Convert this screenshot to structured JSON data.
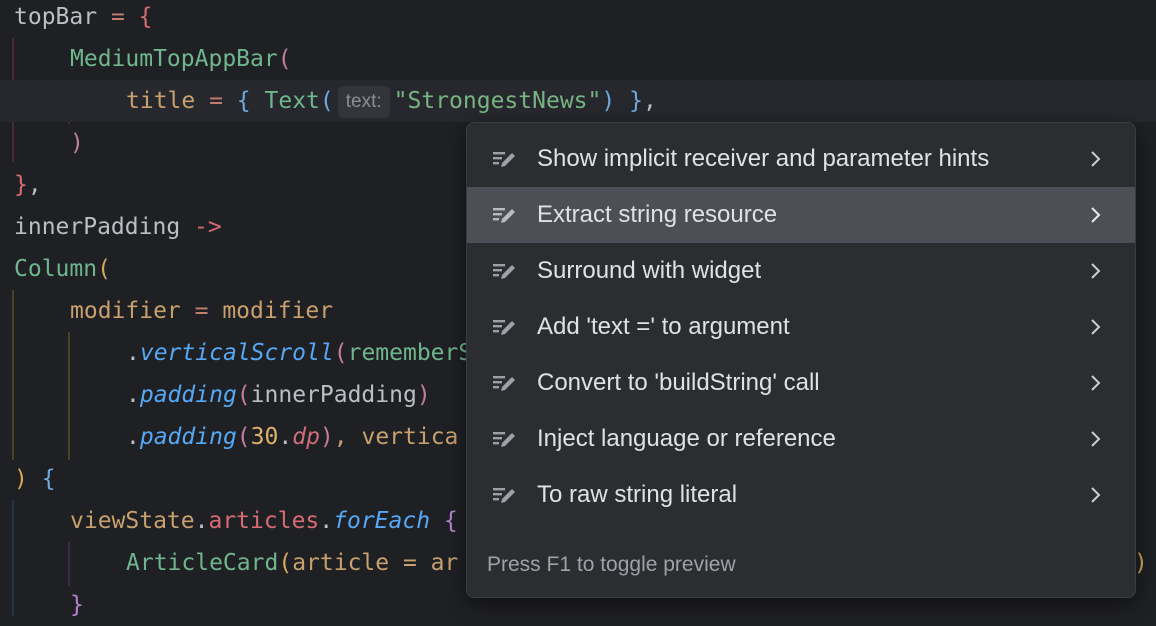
{
  "code": {
    "l1": {
      "name": "topBar",
      "eq": " = ",
      "brace": "{"
    },
    "l2": {
      "fn": "MediumTopAppBar",
      "paren": "("
    },
    "l3": {
      "prop": "title",
      "eq": " = ",
      "lb": "{ ",
      "fn": "Text",
      "paren": "(",
      "hint": "text:",
      "str": "\"StrongestNews\"",
      "rp": ")",
      "rb": " }",
      "comma": ","
    },
    "l4": {
      "paren": ")"
    },
    "l5": {
      "brace": "}",
      "comma": ","
    },
    "l6": {
      "name": "innerPadding",
      "arrow": " ->"
    },
    "l7": {
      "fn": "Column",
      "paren": "("
    },
    "l8": {
      "prop": "modifier",
      "eq": " = ",
      "val": "modifier"
    },
    "l9": {
      "dot": ".",
      "fn": "verticalScroll",
      "paren": "(",
      "arg": "rememberS"
    },
    "l10": {
      "dot": ".",
      "fn": "padding",
      "lp": "(",
      "arg": "innerPadding",
      "rp": ")"
    },
    "l11": {
      "dot": ".",
      "fn": "padding",
      "lp": "(",
      "num": "30",
      "dot2": ".",
      "unit": "dp",
      "rp": ")",
      "rest": ", vertica"
    },
    "l12": {
      "paren": ")",
      "brace": " {"
    },
    "l13": {
      "obj": "viewState",
      "dot": ".",
      "prop": "articles",
      "dot2": ".",
      "fn": "forEach",
      "brace": " {"
    },
    "l14": {
      "fn": "ArticleCard",
      "paren": "(",
      "rest": "article = ar",
      "tail": ")"
    },
    "l15": {
      "brace": "}"
    }
  },
  "popup": {
    "items": [
      {
        "label": "Show implicit receiver and parameter hints"
      },
      {
        "label": "Extract string resource"
      },
      {
        "label": "Surround with widget"
      },
      {
        "label": "Add 'text =' to argument"
      },
      {
        "label": "Convert to 'buildString' call"
      },
      {
        "label": "Inject language or reference"
      },
      {
        "label": "To raw string literal"
      }
    ],
    "footer": "Press F1 to toggle preview"
  }
}
